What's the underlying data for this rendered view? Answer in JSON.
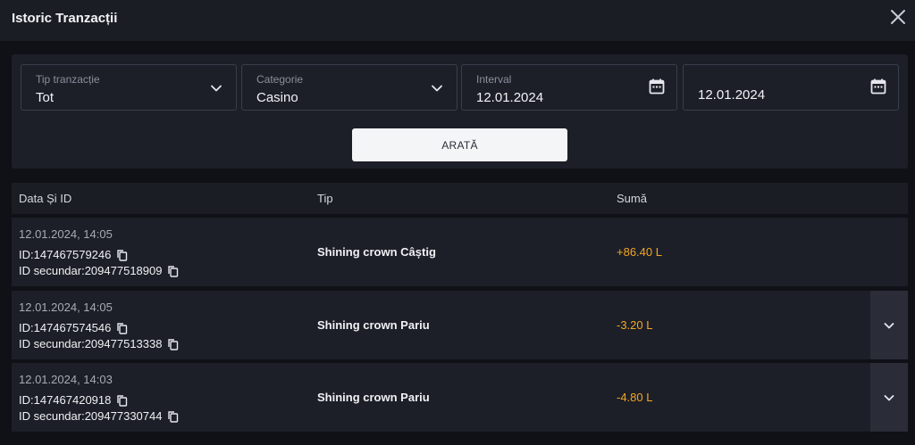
{
  "header": {
    "title": "Istoric Tranzacții",
    "close_icon": "close-icon"
  },
  "filters": {
    "type": {
      "label": "Tip tranzacție",
      "value": "Tot"
    },
    "category": {
      "label": "Categorie",
      "value": "Casino"
    },
    "interval_from": {
      "label": "Interval",
      "value": "12.01.2024"
    },
    "interval_to": {
      "value": "12.01.2024"
    },
    "show_button": "ARATĂ"
  },
  "table": {
    "columns": [
      "Data Și ID",
      "Tip",
      "Sumă"
    ],
    "rows": [
      {
        "date": "12.01.2024, 14:05",
        "id": "ID:147467579246",
        "secondary_id": "ID secundar:209477518909",
        "type": "Shining crown Câștig",
        "amount": "+86.40 L"
      },
      {
        "date": "12.01.2024, 14:05",
        "id": "ID:147467574546",
        "secondary_id": "ID secundar:209477513338",
        "type": "Shining crown Pariu",
        "amount": "-3.20 L"
      },
      {
        "date": "12.01.2024, 14:03",
        "id": "ID:147467420918",
        "secondary_id": "ID secundar:209477330744",
        "type": "Shining crown Pariu",
        "amount": "-4.80 L"
      }
    ]
  },
  "colors": {
    "accent_amount": "#f5a623",
    "background": "#0f1117",
    "panel": "#1c1f28"
  }
}
